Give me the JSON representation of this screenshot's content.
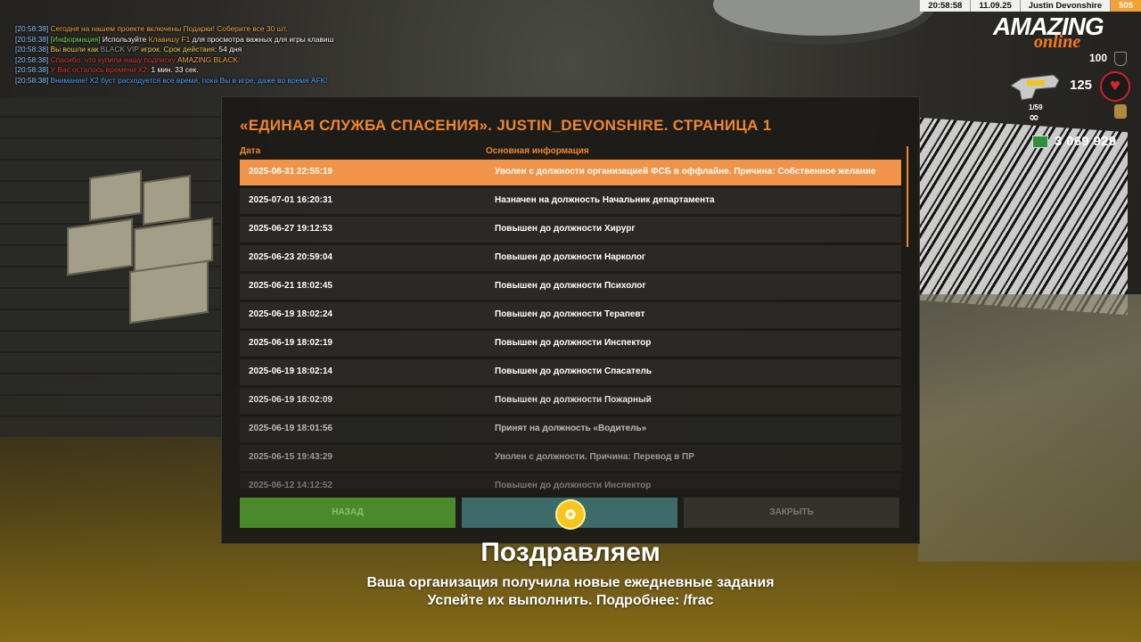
{
  "chat": [
    {
      "time": "[20:58:38]",
      "parts": [
        {
          "text": " Сегодня на нашем проекте включены Подарки! Соберите все 30 шт.",
          "color": "#f5a948"
        }
      ]
    },
    {
      "time": "[20:58:38]",
      "parts": [
        {
          "text": " [Информация] ",
          "color": "#7ed957"
        },
        {
          "text": "Используйте ",
          "color": "#ffffff"
        },
        {
          "text": "Клавишу F1",
          "color": "#f5a948"
        },
        {
          "text": " для просмотра важных для игры клавиш",
          "color": "#ffffff"
        }
      ]
    },
    {
      "time": "[20:58:38]",
      "parts": [
        {
          "text": " Вы вошли как ",
          "color": "#f5d24a"
        },
        {
          "text": "BLACK VIP",
          "color": "#9a9a9a"
        },
        {
          "text": " игрок. Срок действия: ",
          "color": "#f5d24a"
        },
        {
          "text": "54 дня",
          "color": "#ffffff"
        }
      ]
    },
    {
      "time": "[20:58:38]",
      "parts": [
        {
          "text": " Спасибо, что купили нашу подписку ",
          "color": "#e03a3a"
        },
        {
          "text": "AMAZING BLACK",
          "color": "#f5a948"
        },
        {
          "text": "!",
          "color": "#e03a3a"
        }
      ]
    },
    {
      "time": "[20:58:38]",
      "parts": [
        {
          "text": " У Вас осталось времени X2: ",
          "color": "#e03a3a"
        },
        {
          "text": "1 мин. 33 сек.",
          "color": "#ffffff"
        }
      ]
    },
    {
      "time": "[20:58:38]",
      "parts": [
        {
          "text": " Внимание! X2 буст расходуется все время, пока Вы в игре, даже во время AFK!",
          "color": "#4aa3ff"
        }
      ]
    }
  ],
  "topbar": {
    "time": "20:58:58",
    "date": "11.09.25",
    "player": "Justin Devonshire",
    "level": "505"
  },
  "logo": {
    "main": "AMAZING",
    "sub": "online"
  },
  "hud": {
    "armor": "100",
    "health": "125",
    "ammo": "1/59",
    "infinity": "∞",
    "money": "3 069 929"
  },
  "dialog": {
    "title": "«ЕДИНАЯ СЛУЖБА СПАСЕНИЯ». JUSTIN_DEVONSHIRE. СТРАНИЦА 1",
    "col_date": "Дата",
    "col_info": "Основная информация",
    "rows": [
      {
        "date": "2025-08-31 22:55:19",
        "info": "Уволен с должности организацией ФСБ в оффлайне. Причина: Собственное желание"
      },
      {
        "date": "2025-07-01 16:20:31",
        "info": "Назначен на должность Начальник департамента"
      },
      {
        "date": "2025-06-27 19:12:53",
        "info": "Повышен до должности Хирург"
      },
      {
        "date": "2025-06-23 20:59:04",
        "info": "Повышен до должности Нарколог"
      },
      {
        "date": "2025-06-21 18:02:45",
        "info": "Повышен до должности Психолог"
      },
      {
        "date": "2025-06-19 18:02:24",
        "info": "Повышен до должности Терапевт"
      },
      {
        "date": "2025-06-19 18:02:19",
        "info": "Повышен до должности Инспектор"
      },
      {
        "date": "2025-06-19 18:02:14",
        "info": "Повышен до должности Спасатель"
      },
      {
        "date": "2025-06-19 18:02:09",
        "info": "Повышен до должности Пожарный"
      },
      {
        "date": "2025-06-19 18:01:56",
        "info": "Принят на должность «Водитель»"
      },
      {
        "date": "2025-06-15 19:43:29",
        "info": "Уволен с должности. Причина: Перевод в ПР"
      },
      {
        "date": "2025-06-12 14:12:52",
        "info": "Повышен до должности Инспектор"
      }
    ],
    "btn_back": "НАЗАД",
    "btn_close": "ЗАКРЫТЬ",
    "selected_row": 0
  },
  "notification": {
    "title": "Поздравляем",
    "line1": "Ваша организация получила новые ежедневные задания",
    "line2": "Успейте их выполнить. Подробнее: /frac"
  }
}
